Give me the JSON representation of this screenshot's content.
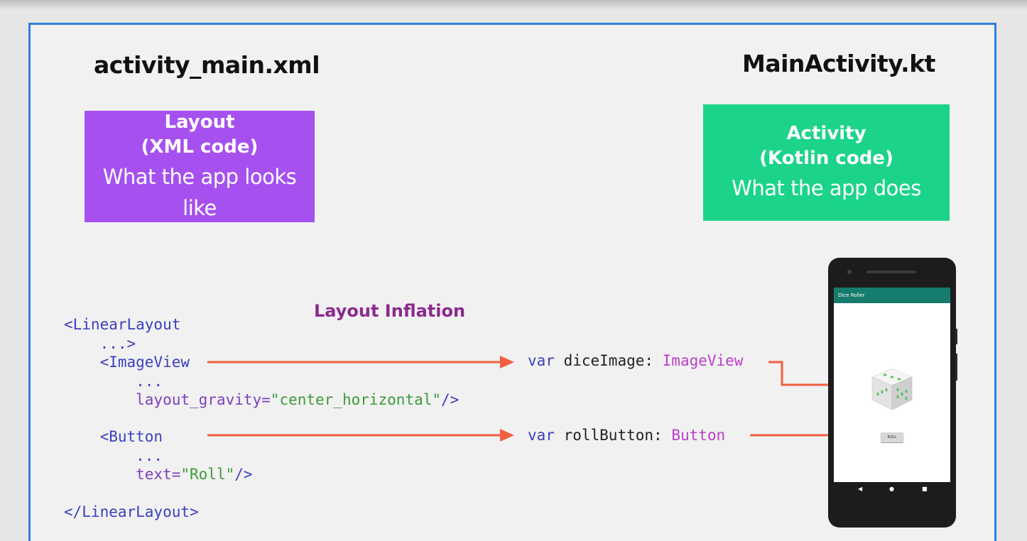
{
  "left_file": "activity_main.xml",
  "right_file": "MainActivity.kt",
  "layout_box": {
    "line1": "Layout",
    "line2": "(XML code)",
    "line3": "What the app looks like",
    "color": "#a651ef"
  },
  "activity_box": {
    "line1": "Activity",
    "line2": "(Kotlin code)",
    "line3": "What the app does",
    "color": "#1bd48a"
  },
  "inflation_label": "Layout Inflation",
  "xml_code": {
    "l1": "<LinearLayout",
    "l2": "    ...>",
    "l3": "    <ImageView",
    "l4": "        ...",
    "l5_attr": "        layout_gravity=",
    "l5_val": "\"center_horizontal\"",
    "l5_end": "/>",
    "l6": "    <Button",
    "l7": "        ...",
    "l8_attr": "        text=",
    "l8_val": "\"Roll\"",
    "l8_end": "/>",
    "l9": "</LinearLayout>"
  },
  "kotlin_code": {
    "v1_kw": "var",
    "v1_name": " diceImage: ",
    "v1_type": "ImageView",
    "v2_kw": "var",
    "v2_name": " rollButton: ",
    "v2_type": "Button"
  },
  "phone": {
    "app_title": "Dice Roller",
    "button_label": "ROLL",
    "nav_back": "◀",
    "nav_home": "●",
    "nav_recent": "■"
  },
  "colors": {
    "arrow": "#f06040",
    "frame": "#2f7fd8"
  }
}
